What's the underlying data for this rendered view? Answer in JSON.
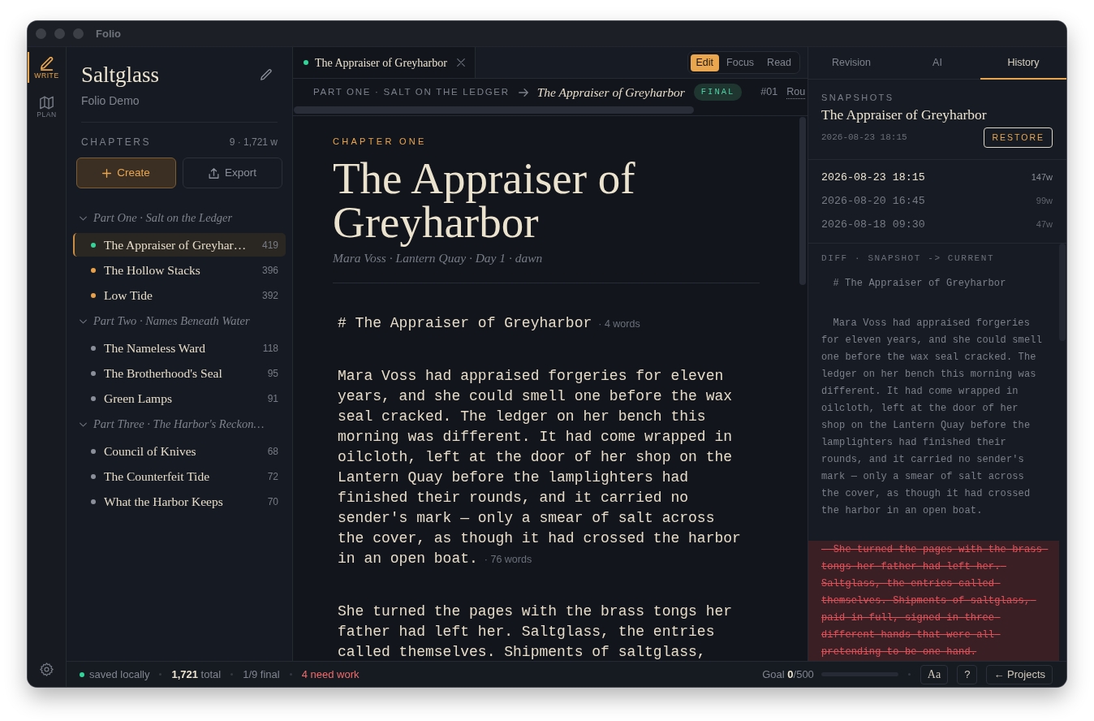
{
  "window": {
    "title": "Folio"
  },
  "activity_bar": {
    "items": [
      {
        "label": "WRITE",
        "selected": true
      },
      {
        "label": "PLAN",
        "selected": false
      }
    ]
  },
  "sidebar": {
    "title": "Saltglass",
    "subtitle": "Folio Demo",
    "section_label": "CHAPTERS",
    "section_count": "9 · 1,721 w",
    "create_button": "Create",
    "export_button": "Export",
    "parts": [
      {
        "title": "Part One · Salt on the Ledger",
        "expanded": true,
        "chapters": [
          {
            "title": "The Appraiser of Greyhar…",
            "words": "419",
            "color": "#34d399",
            "selected": true
          },
          {
            "title": "The Hollow Stacks",
            "words": "396",
            "color": "#e9a04a",
            "selected": false
          },
          {
            "title": "Low Tide",
            "words": "392",
            "color": "#e9a04a",
            "selected": false
          }
        ]
      },
      {
        "title": "Part Two · Names Beneath Water",
        "expanded": true,
        "chapters": [
          {
            "title": "The Nameless Ward",
            "words": "118",
            "color": "#8a8f99",
            "selected": false
          },
          {
            "title": "The Brotherhood's Seal",
            "words": "95",
            "color": "#8a8f99",
            "selected": false
          },
          {
            "title": "Green Lamps",
            "words": "91",
            "color": "#8a8f99",
            "selected": false
          }
        ]
      },
      {
        "title": "Part Three · The Harbor's Reckon…",
        "expanded": true,
        "chapters": [
          {
            "title": "Council of Knives",
            "words": "68",
            "color": "#8a8f99",
            "selected": false
          },
          {
            "title": "The Counterfeit Tide",
            "words": "72",
            "color": "#8a8f99",
            "selected": false
          },
          {
            "title": "What the Harbor Keeps",
            "words": "70",
            "color": "#8a8f99",
            "selected": false
          }
        ]
      }
    ]
  },
  "editor": {
    "tabs": [
      {
        "title": "The Appraiser of Greyharbor",
        "color": "#34d399",
        "selected": true
      }
    ],
    "modes": [
      {
        "label": "Edit",
        "selected": true
      },
      {
        "label": "Focus",
        "selected": false
      },
      {
        "label": "Read",
        "selected": false
      }
    ],
    "breadcrumb": {
      "part": "PART ONE · SALT ON THE LEDGER",
      "chapter": "The Appraiser of Greyharbor",
      "status": "FINAL",
      "number": "#01",
      "link": "Rou"
    },
    "kicker": "CHAPTER ONE",
    "title": "The Appraiser of Greyharbor",
    "meta": "Mara Voss · Lantern Quay · Day 1 · dawn",
    "blocks": [
      {
        "text": "# The Appraiser of Greyharbor",
        "count": "· 4 words"
      },
      {
        "text": "Mara Voss had appraised forgeries for eleven years, and she could smell one before the wax seal cracked. The ledger on her bench this morning was different. It had come wrapped in oilcloth, left at the door of her shop on the Lantern Quay before the lamplighters had finished their rounds, and it carried no sender's mark — only a smear of salt across the cover, as though it had crossed the harbor in an open boat.",
        "count": "· 76 words"
      },
      {
        "text": "She turned the pages with the brass tongs her father had left her. Saltglass, the entries called themselves. Shipments of saltglass,"
      }
    ]
  },
  "history_panel": {
    "tabs": [
      {
        "label": "Revision",
        "selected": false
      },
      {
        "label": "AI",
        "selected": false
      },
      {
        "label": "History",
        "selected": true
      }
    ],
    "section_label": "SNAPSHOTS",
    "snapshot_title": "The Appraiser of Greyharbor",
    "snapshot_time": "2026-08-23 18:15",
    "restore_button": "RESTORE",
    "snapshots": [
      {
        "time": "2026-08-23 18:15",
        "words": "147w",
        "selected": true
      },
      {
        "time": "2026-08-20 16:45",
        "words": "99w",
        "selected": false
      },
      {
        "time": "2026-08-18 09:30",
        "words": "47w",
        "selected": false
      }
    ],
    "diff_label": "DIFF · SNAPSHOT -> CURRENT",
    "diff": [
      {
        "kind": "same",
        "text": "# The Appraiser of Greyharbor"
      },
      {
        "kind": "same",
        "text": "Mara Voss had appraised forgeries for eleven years, and she could smell one before the wax seal cracked. The ledger on her bench this morning was different. It had come wrapped in oilcloth, left at the door of her shop on the Lantern Quay before the lamplighters had finished their rounds, and it carried no sender's mark — only a smear of salt across the cover, as though it had crossed the harbor in an open boat."
      },
      {
        "kind": "removed",
        "text": "- She turned the pages with the brass tongs her father had left her. Saltglass, the entries called themselves. Shipments of saltglass, paid in full, signed in three different hands that were all pretending to be one hand."
      }
    ]
  },
  "status_bar": {
    "save_state": "saved locally",
    "total": "**1,721** total",
    "final": "1/9 final",
    "need_work": "4 need work",
    "goal": "Goal **0**/500",
    "goal_progress": {
      "level": 0
    },
    "buttons": [
      {
        "label": "Aa",
        "kind": "typeface"
      },
      {
        "label": "?",
        "kind": "text"
      },
      {
        "label": "← Projects",
        "kind": "text"
      }
    ]
  }
}
